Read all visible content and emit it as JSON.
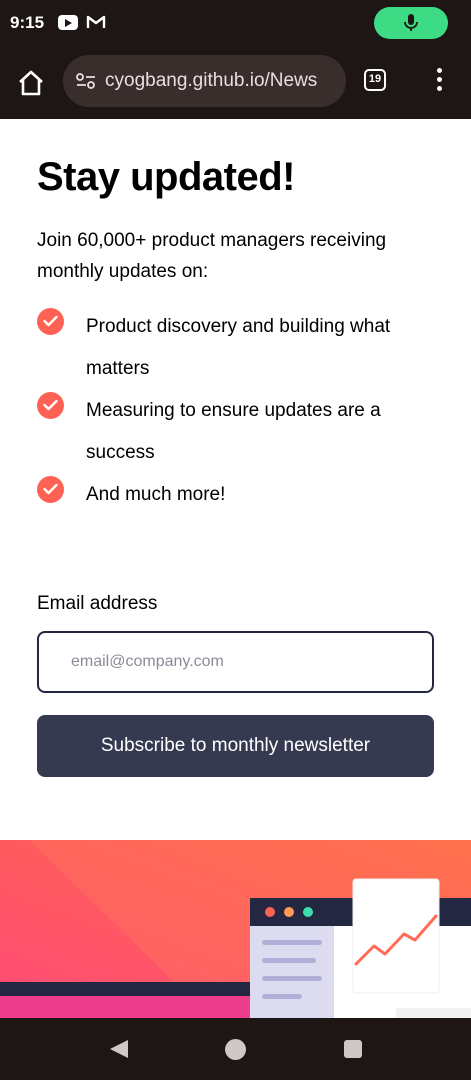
{
  "status_bar": {
    "time": "9:15"
  },
  "browser": {
    "url": "cyogbang.github.io/News",
    "tab_count": "19"
  },
  "page": {
    "title": "Stay updated!",
    "intro": "Join 60,000+ product managers receiving monthly updates on:",
    "features": [
      "Product discovery and building what matters",
      "Measuring to ensure updates are a success",
      "And much more!"
    ],
    "email_label": "Email address",
    "email_placeholder": "email@company.com",
    "email_value": "",
    "subscribe_label": "Subscribe to monthly newsletter"
  },
  "colors": {
    "accent": "#ff6155",
    "dark_navy": "#242742",
    "button": "#363a51",
    "mic": "#3ddc84"
  }
}
